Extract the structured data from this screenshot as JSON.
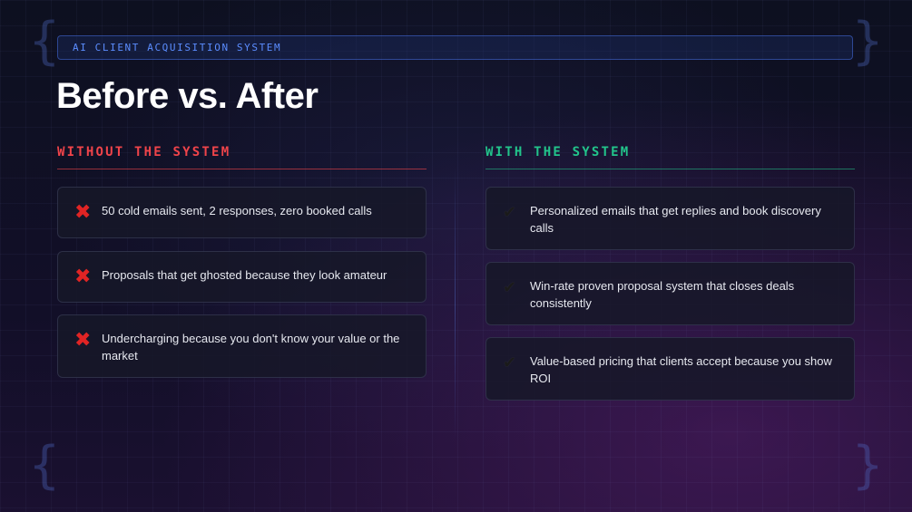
{
  "header": {
    "tag": "AI CLIENT ACQUISITION SYSTEM",
    "title": "Before vs. After"
  },
  "left": {
    "heading": "WITHOUT THE SYSTEM",
    "icon": "cross-mark-icon",
    "color": "#f0444a",
    "items": [
      "50 cold emails sent, 2 responses, zero booked calls",
      "Proposals that get ghosted because they look amateur",
      "Undercharging because you don't know your value or the market"
    ]
  },
  "right": {
    "heading": "WITH THE SYSTEM",
    "icon": "check-mark-icon",
    "color": "#22c58b",
    "items": [
      "Personalized emails that get replies and book discovery calls",
      "Win-rate proven proposal system that closes deals consistently",
      "Value-based pricing that clients accept because you show ROI"
    ]
  }
}
